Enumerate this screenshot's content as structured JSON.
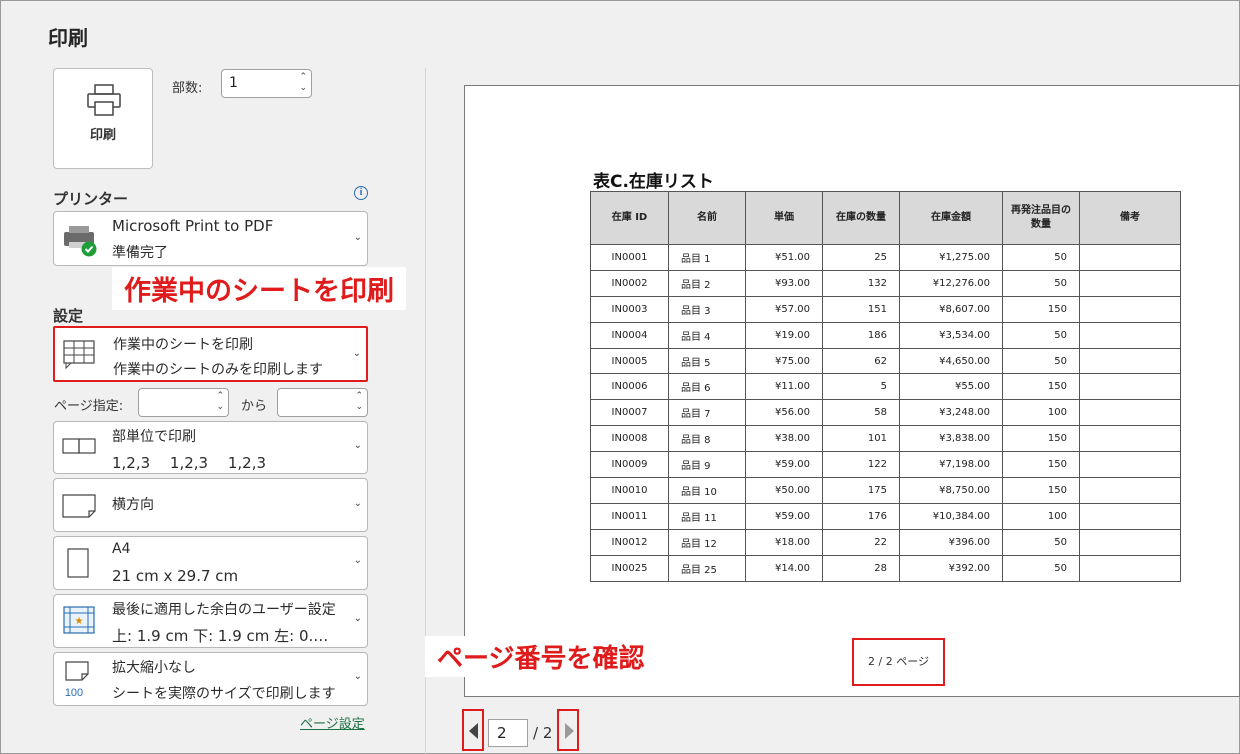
{
  "title": "印刷",
  "print_button": {
    "label": "印刷"
  },
  "copies": {
    "label": "部数:",
    "value": "1"
  },
  "printer": {
    "section_label": "プリンター",
    "name": "Microsoft Print to PDF",
    "status": "準備完了"
  },
  "settings": {
    "section_label": "設定",
    "print_what": {
      "line1": "作業中のシートを印刷",
      "line2": "作業中のシートのみを印刷します"
    },
    "pages": {
      "label": "ページ指定:",
      "to_label": "から",
      "from_value": "",
      "to_value": ""
    },
    "collation": {
      "line1": "部単位で印刷",
      "line2": "1,2,3　 1,2,3　 1,2,3"
    },
    "orientation": {
      "line1": "横方向"
    },
    "paper": {
      "line1": "A4",
      "line2": "21 cm x 29.7 cm"
    },
    "margins": {
      "line1": "最後に適用した余白のユーザー設定",
      "line2": "上: 1.9 cm 下: 1.9 cm 左: 0.…"
    },
    "scaling": {
      "line1": "拡大縮小なし",
      "line2": "シートを実際のサイズで印刷します"
    },
    "page_setup_link": "ページ設定"
  },
  "callouts": {
    "sheet": "作業中のシートを印刷",
    "page_number": "ページ番号を確認"
  },
  "preview": {
    "table_title": "表C.在庫リスト",
    "headers": [
      "在庫 ID",
      "名前",
      "単価",
      "在庫の数量",
      "在庫金額",
      "再発注品目の数量",
      "備考"
    ],
    "rows": [
      [
        "IN0001",
        "品目 1",
        "¥51.00",
        "25",
        "¥1,275.00",
        "50",
        ""
      ],
      [
        "IN0002",
        "品目 2",
        "¥93.00",
        "132",
        "¥12,276.00",
        "50",
        ""
      ],
      [
        "IN0003",
        "品目 3",
        "¥57.00",
        "151",
        "¥8,607.00",
        "150",
        ""
      ],
      [
        "IN0004",
        "品目 4",
        "¥19.00",
        "186",
        "¥3,534.00",
        "50",
        ""
      ],
      [
        "IN0005",
        "品目 5",
        "¥75.00",
        "62",
        "¥4,650.00",
        "50",
        ""
      ],
      [
        "IN0006",
        "品目 6",
        "¥11.00",
        "5",
        "¥55.00",
        "150",
        ""
      ],
      [
        "IN0007",
        "品目 7",
        "¥56.00",
        "58",
        "¥3,248.00",
        "100",
        ""
      ],
      [
        "IN0008",
        "品目 8",
        "¥38.00",
        "101",
        "¥3,838.00",
        "150",
        ""
      ],
      [
        "IN0009",
        "品目 9",
        "¥59.00",
        "122",
        "¥7,198.00",
        "150",
        ""
      ],
      [
        "IN0010",
        "品目 10",
        "¥50.00",
        "175",
        "¥8,750.00",
        "150",
        ""
      ],
      [
        "IN0011",
        "品目 11",
        "¥59.00",
        "176",
        "¥10,384.00",
        "100",
        ""
      ],
      [
        "IN0012",
        "品目 12",
        "¥18.00",
        "22",
        "¥396.00",
        "50",
        ""
      ],
      [
        "IN0025",
        "品目 25",
        "¥14.00",
        "28",
        "¥392.00",
        "50",
        ""
      ]
    ],
    "page_footer": "2 / 2 ページ"
  },
  "nav": {
    "current_page": "2",
    "total": "/ 2"
  },
  "colors": {
    "highlight": "#e01b1b",
    "link": "#1e7145",
    "header_fill": "#d9d9d9"
  }
}
